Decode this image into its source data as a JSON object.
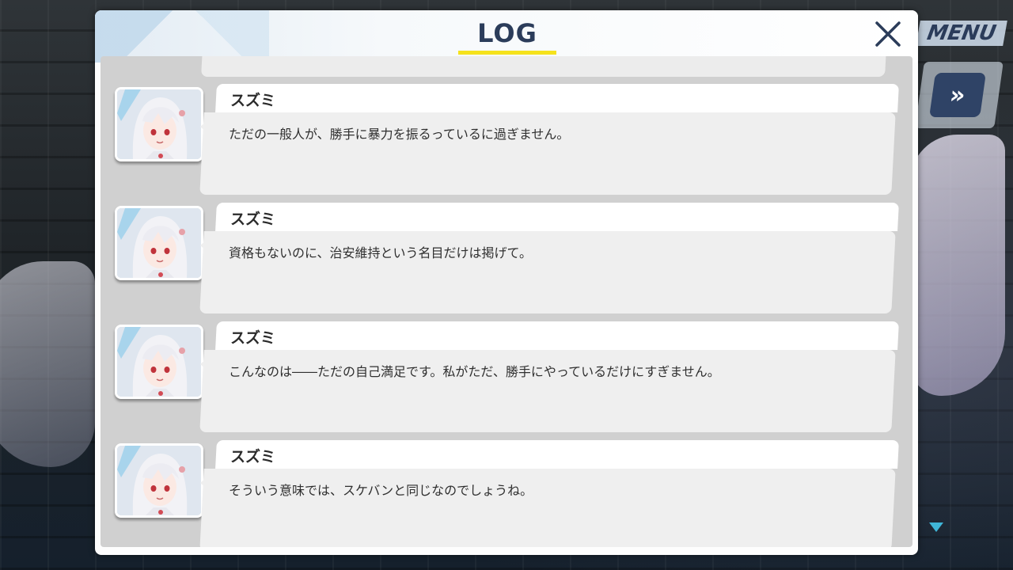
{
  "panel": {
    "title": "LOG"
  },
  "side_ui": {
    "menu_label": "MENU",
    "skip_label": "»"
  },
  "entries": [
    {
      "speaker": "スズミ",
      "text": "ただの一般人が、勝手に暴力を振るっているに過ぎません。"
    },
    {
      "speaker": "スズミ",
      "text": "資格もないのに、治安維持という名目だけは掲げて。"
    },
    {
      "speaker": "スズミ",
      "text": "こんなのは――ただの自己満足です。私がただ、勝手にやっているだけにすぎません。"
    },
    {
      "speaker": "スズミ",
      "text": "そういう意味では、スケバンと同じなのでしょうね。"
    }
  ],
  "colors": {
    "title": "#2b3c5a",
    "underline": "#f5e21c",
    "list_bg": "#d0d0d0",
    "bubble": "#efefef"
  },
  "icons": {
    "close": "close-icon",
    "skip": "fast-forward-icon",
    "scroll": "scroll-down-indicator-icon"
  }
}
